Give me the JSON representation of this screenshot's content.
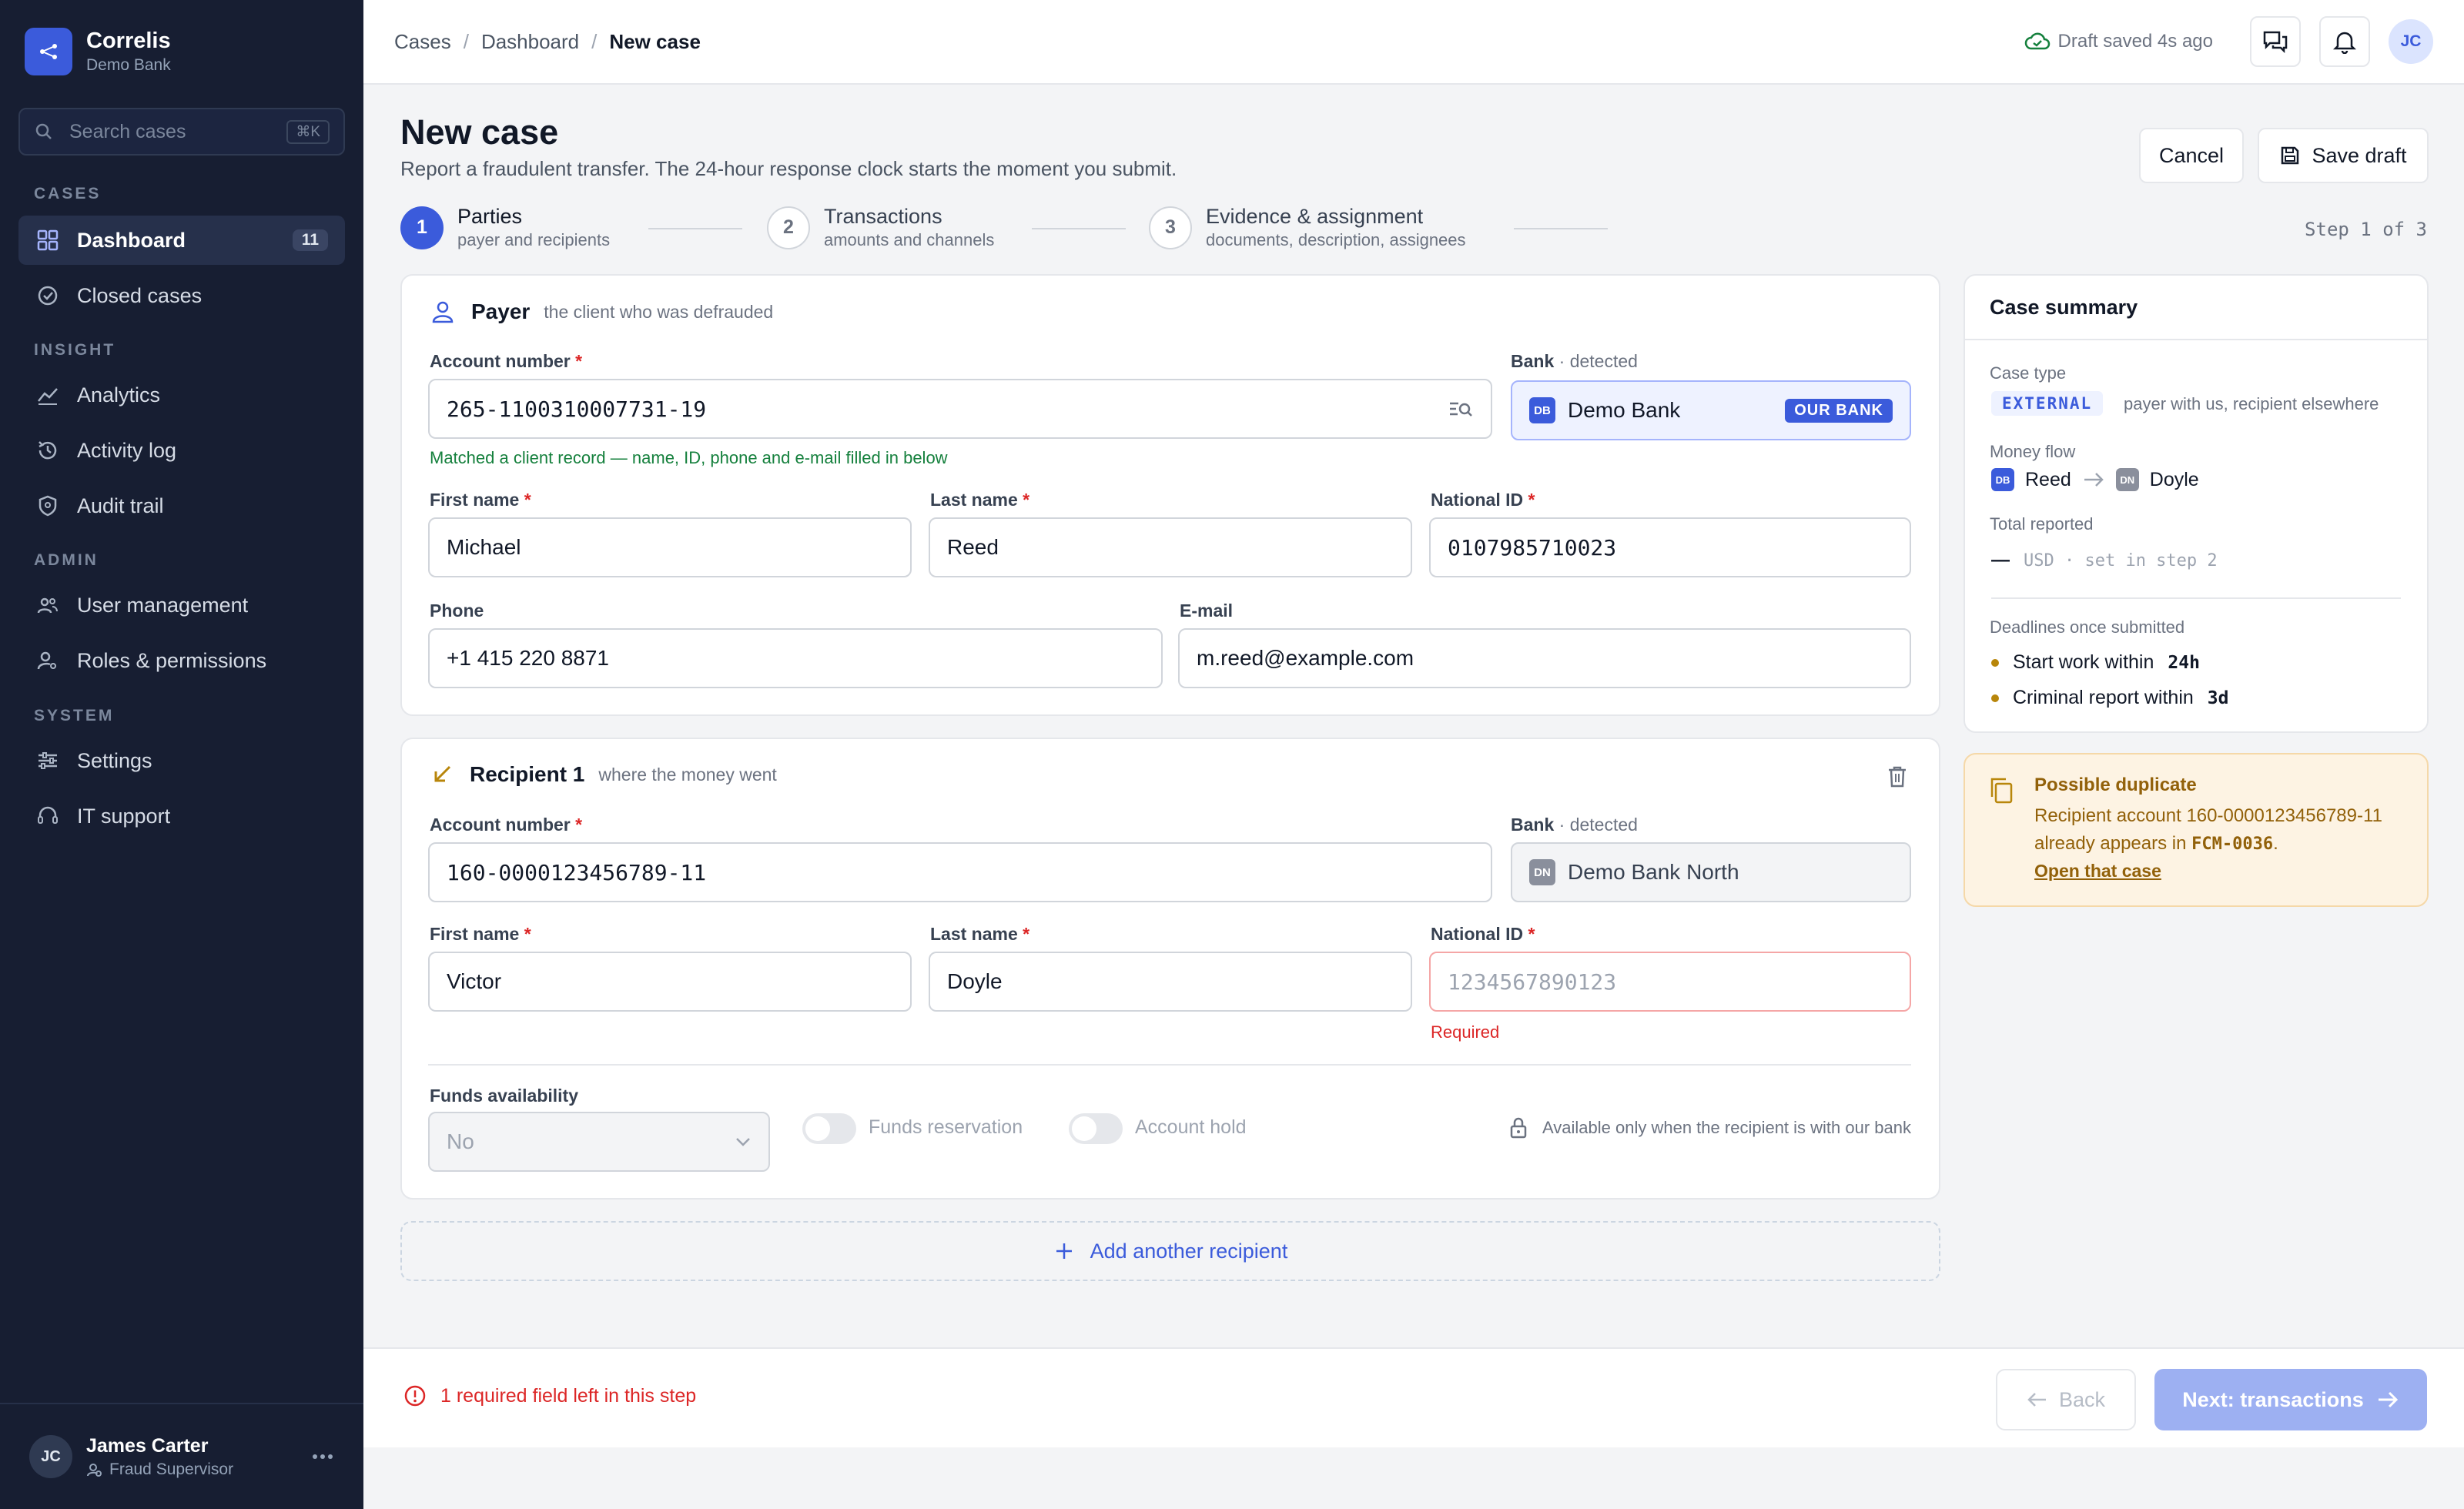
{
  "app": {
    "name": "Correlis",
    "org": "Demo Bank"
  },
  "search": {
    "placeholder": "Search cases",
    "shortcut": "⌘K"
  },
  "sidebar": {
    "sections": [
      "CASES",
      "INSIGHT",
      "ADMIN",
      "SYSTEM"
    ],
    "items": [
      {
        "label": "Dashboard",
        "icon": "grid-icon",
        "count": "11"
      },
      {
        "label": "Closed cases",
        "icon": "check-circle-icon"
      },
      {
        "label": "Analytics",
        "icon": "chart-line-icon"
      },
      {
        "label": "Activity log",
        "icon": "history-icon"
      },
      {
        "label": "Audit trail",
        "icon": "shield-icon"
      },
      {
        "label": "User management",
        "icon": "users-icon"
      },
      {
        "label": "Roles & permissions",
        "icon": "user-key-icon"
      },
      {
        "label": "Settings",
        "icon": "sliders-icon"
      },
      {
        "label": "IT support",
        "icon": "headset-icon"
      }
    ]
  },
  "user": {
    "initials": "JC",
    "name": "James Carter",
    "role": "Fraud Supervisor"
  },
  "breadcrumb": [
    "Cases",
    "Dashboard",
    "New case"
  ],
  "topbar": {
    "draft_status": "Draft saved 4s ago",
    "avatar": "JC"
  },
  "page": {
    "title": "New case",
    "subtitle": "Report a fraudulent transfer. The 24-hour response clock starts the moment you submit.",
    "cancel": "Cancel",
    "save_draft": "Save draft"
  },
  "steps": [
    {
      "num": "1",
      "title": "Parties",
      "sub": "payer and recipients"
    },
    {
      "num": "2",
      "title": "Transactions",
      "sub": "amounts and channels"
    },
    {
      "num": "3",
      "title": "Evidence & assignment",
      "sub": "documents, description, assignees"
    }
  ],
  "step_counter": "Step 1 of 3",
  "payer": {
    "title": "Payer",
    "hint": "the client who was defrauded",
    "account_label": "Account number",
    "account": "265-1100310007731-19",
    "bank_label": "Bank",
    "bank_detected": "· detected",
    "bank_badge": "DB",
    "bank": "Demo Bank",
    "bank_tag": "OUR BANK",
    "match_msg": "Matched a client record — name, ID, phone and e-mail filled in below",
    "first_label": "First name",
    "first": "Michael",
    "last_label": "Last name",
    "last": "Reed",
    "nid_label": "National ID",
    "nid": "0107985710023",
    "phone_label": "Phone",
    "phone": "+1 415 220 8871",
    "email_label": "E-mail",
    "email": "m.reed@example.com"
  },
  "recipient": {
    "title": "Recipient 1",
    "hint": "where the money went",
    "account_label": "Account number",
    "account": "160-0000123456789-11",
    "bank_label": "Bank",
    "bank_detected": "· detected",
    "bank_badge": "DN",
    "bank": "Demo Bank North",
    "first_label": "First name",
    "first": "Victor",
    "last_label": "Last name",
    "last": "Doyle",
    "nid_label": "National ID",
    "nid_placeholder": "1234567890123",
    "nid_error": "Required",
    "funds_label": "Funds availability",
    "funds_value": "No",
    "reservation": "Funds reservation",
    "hold": "Account hold",
    "lock_note": "Available only when the recipient is with our bank"
  },
  "add_recipient": "Add another recipient",
  "summary": {
    "title": "Case summary",
    "case_type_label": "Case type",
    "case_type": "EXTERNAL",
    "case_type_note": "payer with us, recipient elsewhere",
    "flow_label": "Money flow",
    "from_badge": "DB",
    "from": "Reed",
    "to_badge": "DN",
    "to": "Doyle",
    "total_label": "Total reported",
    "total_dash": "—",
    "total_note": "USD · set in step 2",
    "deadlines_label": "Deadlines once submitted",
    "deadlines": [
      {
        "label": "Start work within",
        "value": "24h"
      },
      {
        "label": "Criminal report within",
        "value": "3d"
      }
    ]
  },
  "duplicate": {
    "title": "Possible duplicate",
    "text_pre": "Recipient account 160-0000123456789-11 already appears in",
    "case_id": "FCM-0036",
    "text_post": ".",
    "link": "Open that case"
  },
  "footer": {
    "error": "1 required field left in this step",
    "back": "Back",
    "next": "Next: transactions"
  },
  "colors": {
    "accent": "#3b5bdb",
    "error": "#dc2626",
    "success": "#15803d",
    "warning": "#b8860b",
    "sidebar": "#171e32"
  }
}
